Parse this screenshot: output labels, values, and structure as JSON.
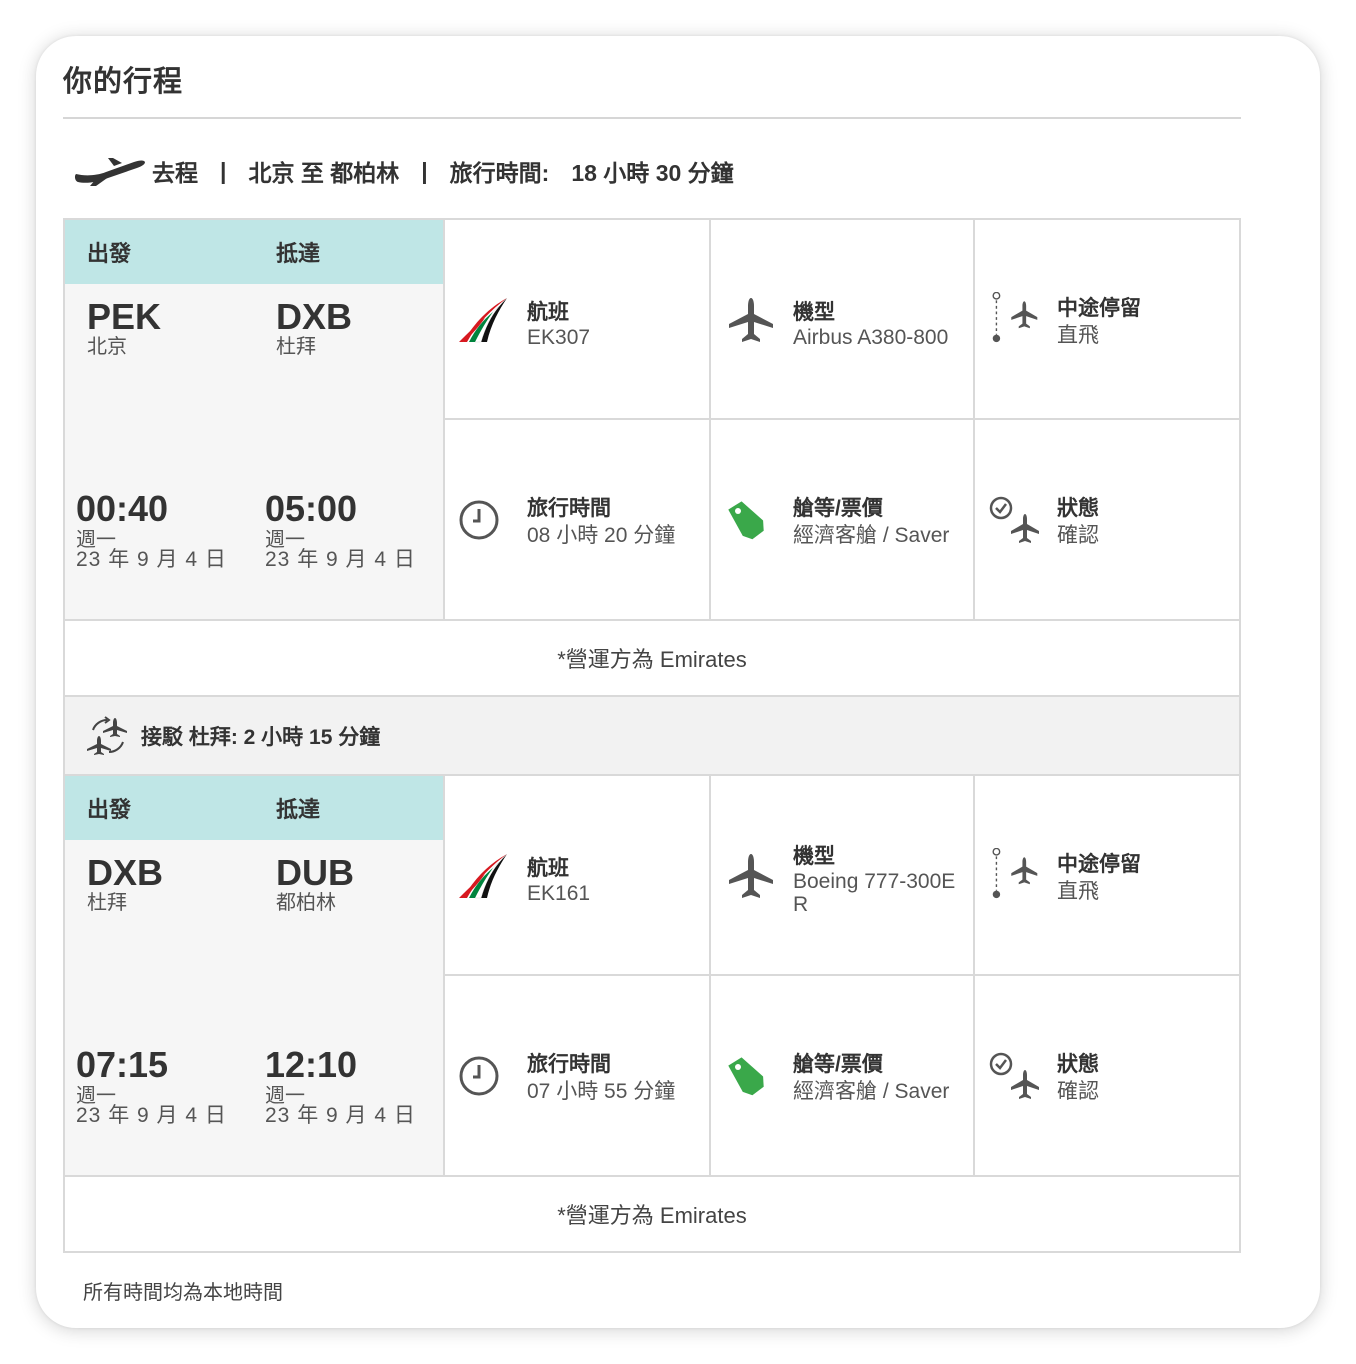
{
  "page_title": "你的行程",
  "summary": {
    "direction": "去程",
    "route": "北京 至 都柏林",
    "duration_label": "旅行時間:",
    "duration": "18 小時 30 分鐘",
    "separator": "|"
  },
  "connection": {
    "text": "接駁 杜拜: 2 小時 15 分鐘"
  },
  "segments": [
    {
      "dep_header": "出發",
      "arr_header": "抵達",
      "dep_code": "PEK",
      "dep_city": "北京",
      "arr_code": "DXB",
      "arr_city": "杜拜",
      "dep_time": "00:40",
      "dep_dow": "週一",
      "dep_date": "23 年 9 月 4 日",
      "arr_time": "05:00",
      "arr_dow": "週一",
      "arr_date": "23 年 9 月 4 日",
      "flight_label": "航班",
      "flight": "EK307",
      "aircraft_label": "機型",
      "aircraft": "Airbus A380-800",
      "stops_label": "中途停留",
      "stops": "直飛",
      "duration_label": "旅行時間",
      "duration": "08 小時 20 分鐘",
      "fare_label": "艙等/票價",
      "fare": "經濟客艙 / Saver",
      "status_label": "狀態",
      "status": "確認",
      "operator": "*營運方為 Emirates"
    },
    {
      "dep_header": "出發",
      "arr_header": "抵達",
      "dep_code": "DXB",
      "dep_city": "杜拜",
      "arr_code": "DUB",
      "arr_city": "都柏林",
      "dep_time": "07:15",
      "dep_dow": "週一",
      "dep_date": "23 年 9 月 4 日",
      "arr_time": "12:10",
      "arr_dow": "週一",
      "arr_date": "23 年 9 月 4 日",
      "flight_label": "航班",
      "flight": "EK161",
      "aircraft_label": "機型",
      "aircraft": "Boeing 777-300ER",
      "stops_label": "中途停留",
      "stops": "直飛",
      "duration_label": "旅行時間",
      "duration": "07 小時 55 分鐘",
      "fare_label": "艙等/票價",
      "fare": "經濟客艙 / Saver",
      "status_label": "狀態",
      "status": "確認",
      "operator": "*營運方為 Emirates"
    }
  ],
  "footnote": "所有時間均為本地時間",
  "icons": {
    "summary": "departing-plane-icon",
    "airline": "emirates-logo-icon",
    "aircraft": "airplane-icon",
    "stops": "route-stops-icon",
    "duration": "clock-icon",
    "fare": "price-tag-icon",
    "status": "confirmed-status-icon",
    "connection": "connecting-flight-icon"
  },
  "colors": {
    "header_bg": "#bfe6e6",
    "tag_green": "#3aa84a",
    "emirates_red": "#d71920",
    "emirates_green": "#00843d"
  }
}
